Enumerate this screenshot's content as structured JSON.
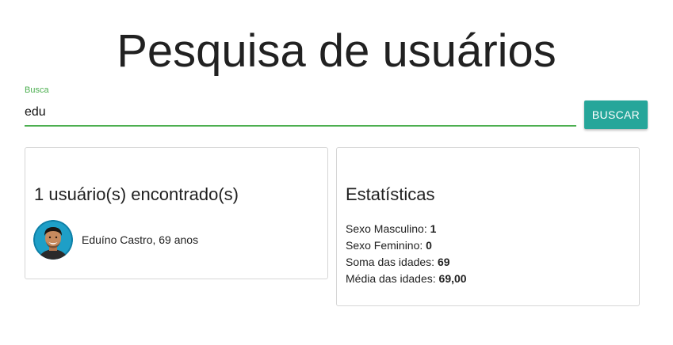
{
  "page": {
    "title": "Pesquisa de usuários"
  },
  "search": {
    "label": "Busca",
    "value": "edu",
    "button_label": "BUSCAR",
    "accent_color": "#4caf50",
    "button_color": "#26a69a"
  },
  "results": {
    "title": "1 usuário(s) encontrado(s)",
    "users": [
      {
        "text": "Eduíno Castro, 69 anos",
        "avatar_icon": "user-avatar-photo"
      }
    ]
  },
  "stats": {
    "title": "Estatísticas",
    "items": [
      {
        "label": "Sexo Masculino: ",
        "value": "1"
      },
      {
        "label": "Sexo Feminino: ",
        "value": "0"
      },
      {
        "label": "Soma das idades: ",
        "value": "69"
      },
      {
        "label": "Média das idades: ",
        "value": "69,00"
      }
    ]
  }
}
